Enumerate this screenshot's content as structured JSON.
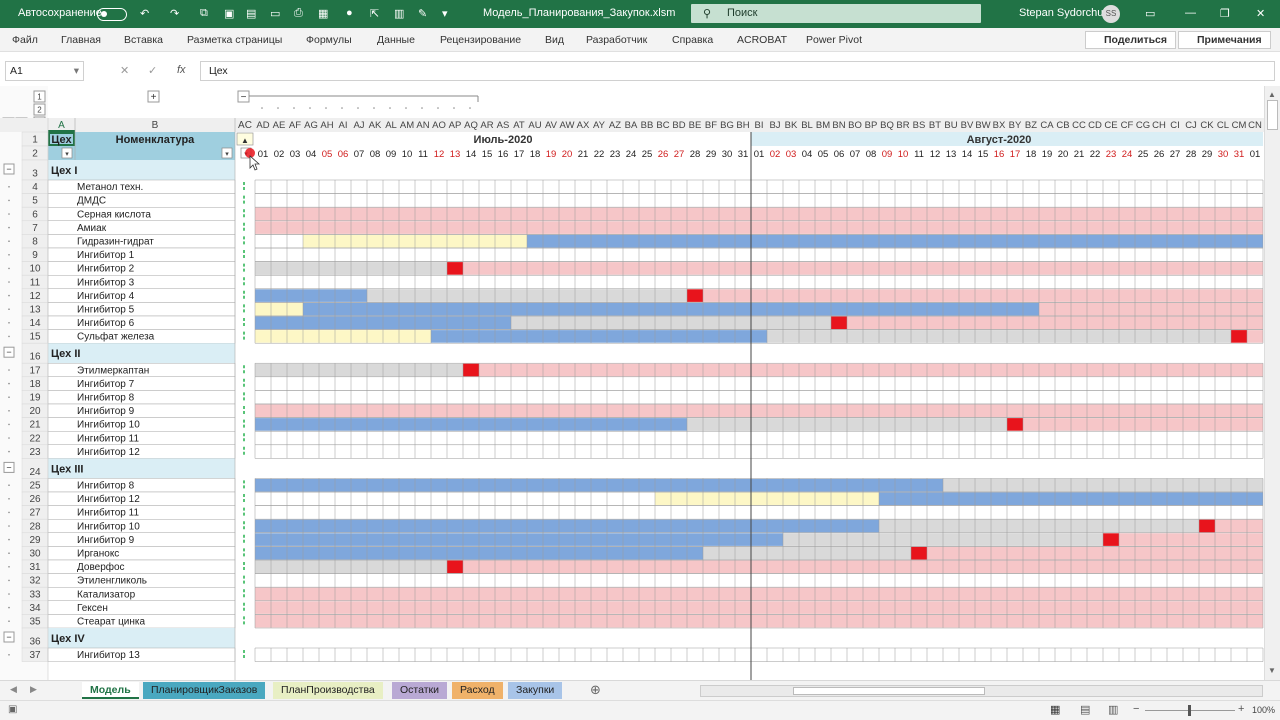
{
  "titlebar": {
    "autosave_label": "Автосохранение",
    "filename": "Модель_Планирования_Закупок.xlsm",
    "search_placeholder": "Поиск",
    "user": "Stepan Sydorchuk",
    "user_initials": "SS"
  },
  "ribbon": {
    "tabs": [
      "Файл",
      "Главная",
      "Вставка",
      "Разметка страницы",
      "Формулы",
      "Данные",
      "Рецензирование",
      "Вид",
      "Разработчик",
      "Справка",
      "ACROBAT",
      "Power Pivot"
    ],
    "share": "Поделиться",
    "comments": "Примечания"
  },
  "formulabar": {
    "name_box": "A1",
    "fx": "fx",
    "value": "Цех"
  },
  "sheet": {
    "col_a": "A",
    "col_b": "B",
    "header_a": "Цех",
    "header_b": "Номенклатура",
    "months": [
      "Июль-2020",
      "Август-2020"
    ],
    "col_letters": [
      "AC",
      "AD",
      "AE",
      "AF",
      "AG",
      "AH",
      "AI",
      "AJ",
      "AK",
      "AL",
      "AM",
      "AN",
      "AO",
      "AP",
      "AQ",
      "AR",
      "AS",
      "AT",
      "AU",
      "AV",
      "AW",
      "AX",
      "AY",
      "AZ",
      "BA",
      "BB",
      "BC",
      "BD",
      "BE",
      "BF",
      "BG",
      "BH",
      "BI",
      "BJ",
      "BK",
      "BL",
      "BM",
      "BN",
      "BO",
      "BP",
      "BQ",
      "BR",
      "BS",
      "BT",
      "BU",
      "BV",
      "BW",
      "BX",
      "BY",
      "BZ",
      "CA",
      "CB",
      "CC",
      "CD",
      "CE",
      "CF",
      "CG",
      "CH",
      "CI",
      "CJ",
      "CK",
      "CL",
      "CM",
      "CN"
    ],
    "days": [
      "01",
      "02",
      "03",
      "04",
      "05",
      "06",
      "07",
      "08",
      "09",
      "10",
      "11",
      "12",
      "13",
      "14",
      "15",
      "16",
      "17",
      "18",
      "19",
      "20",
      "21",
      "22",
      "23",
      "24",
      "25",
      "26",
      "27",
      "28",
      "29",
      "30",
      "31",
      "01",
      "02",
      "03",
      "04",
      "05",
      "06",
      "07",
      "08",
      "09",
      "10",
      "11",
      "12",
      "13",
      "14",
      "15",
      "16",
      "17",
      "18",
      "19",
      "20",
      "21",
      "22",
      "23",
      "24",
      "25",
      "26",
      "27",
      "28",
      "29",
      "30",
      "31",
      "01"
    ],
    "weekend_days": [
      4,
      5,
      11,
      12,
      18,
      19,
      25,
      26,
      32,
      33,
      39,
      40,
      46,
      47,
      53,
      54,
      60,
      61
    ],
    "rows": [
      {
        "n": "1",
        "type": "header"
      },
      {
        "n": "2",
        "type": "filter"
      },
      {
        "n": "3",
        "type": "group",
        "label": "Цех I"
      },
      {
        "n": "4",
        "type": "item",
        "label": "Метанол техн.",
        "pattern": "white"
      },
      {
        "n": "5",
        "type": "item",
        "label": "ДМДС",
        "pattern": "white"
      },
      {
        "n": "6",
        "type": "item",
        "label": "Серная кислота",
        "pattern": "pink"
      },
      {
        "n": "7",
        "type": "item",
        "label": "Амиак",
        "pattern": "pink"
      },
      {
        "n": "8",
        "type": "item",
        "label": "Гидразин-гидрат",
        "segments": [
          [
            0,
            3,
            "white"
          ],
          [
            3,
            17,
            "yellow"
          ],
          [
            17,
            63,
            "blue"
          ]
        ]
      },
      {
        "n": "9",
        "type": "item",
        "label": "Ингибитор 1",
        "pattern": "white"
      },
      {
        "n": "10",
        "type": "item",
        "label": "Ингибитор 2",
        "segments": [
          [
            0,
            12,
            "gray"
          ],
          [
            12,
            13,
            "red"
          ],
          [
            13,
            63,
            "pink"
          ]
        ]
      },
      {
        "n": "11",
        "type": "item",
        "label": "Ингибитор 3",
        "pattern": "white"
      },
      {
        "n": "12",
        "type": "item",
        "label": "Ингибитор 4",
        "segments": [
          [
            0,
            7,
            "blue"
          ],
          [
            7,
            27,
            "gray"
          ],
          [
            27,
            28,
            "red"
          ],
          [
            28,
            63,
            "pink"
          ]
        ]
      },
      {
        "n": "13",
        "type": "item",
        "label": "Ингибитор 5",
        "segments": [
          [
            0,
            3,
            "yellow"
          ],
          [
            3,
            49,
            "blue"
          ],
          [
            49,
            63,
            "pink"
          ]
        ]
      },
      {
        "n": "14",
        "type": "item",
        "label": "Ингибитор 6",
        "segments": [
          [
            0,
            16,
            "blue"
          ],
          [
            16,
            36,
            "gray"
          ],
          [
            36,
            37,
            "red"
          ],
          [
            37,
            63,
            "pink"
          ]
        ]
      },
      {
        "n": "15",
        "type": "item",
        "label": "Сульфат железа",
        "segments": [
          [
            0,
            11,
            "yellow"
          ],
          [
            11,
            32,
            "blue"
          ],
          [
            32,
            61,
            "gray"
          ],
          [
            61,
            62,
            "red"
          ],
          [
            62,
            63,
            "pink"
          ]
        ]
      },
      {
        "n": "16",
        "type": "group",
        "label": "Цех II"
      },
      {
        "n": "17",
        "type": "item",
        "label": "Этилмеркаптан",
        "segments": [
          [
            0,
            13,
            "gray"
          ],
          [
            13,
            14,
            "red"
          ],
          [
            14,
            63,
            "pink"
          ]
        ]
      },
      {
        "n": "18",
        "type": "item",
        "label": "Ингибитор 7",
        "pattern": "white"
      },
      {
        "n": "19",
        "type": "item",
        "label": "Ингибитор 8",
        "pattern": "white"
      },
      {
        "n": "20",
        "type": "item",
        "label": "Ингибитор 9",
        "pattern": "pink"
      },
      {
        "n": "21",
        "type": "item",
        "label": "Ингибитор 10",
        "segments": [
          [
            0,
            27,
            "blue"
          ],
          [
            27,
            47,
            "gray"
          ],
          [
            47,
            48,
            "red"
          ],
          [
            48,
            63,
            "pink"
          ]
        ]
      },
      {
        "n": "22",
        "type": "item",
        "label": "Ингибитор 11",
        "pattern": "white"
      },
      {
        "n": "23",
        "type": "item",
        "label": "Ингибитор 12",
        "pattern": "white"
      },
      {
        "n": "24",
        "type": "group",
        "label": "Цех III"
      },
      {
        "n": "25",
        "type": "item",
        "label": "Ингибитор 8",
        "segments": [
          [
            0,
            43,
            "blue"
          ],
          [
            43,
            63,
            "gray"
          ]
        ]
      },
      {
        "n": "26",
        "type": "item",
        "label": "Ингибитор 12",
        "segments": [
          [
            0,
            25,
            "white"
          ],
          [
            25,
            39,
            "yellow"
          ],
          [
            39,
            63,
            "blue"
          ]
        ]
      },
      {
        "n": "27",
        "type": "item",
        "label": "Ингибитор 11",
        "pattern": "white"
      },
      {
        "n": "28",
        "type": "item",
        "label": "Ингибитор 10",
        "segments": [
          [
            0,
            39,
            "blue"
          ],
          [
            39,
            59,
            "gray"
          ],
          [
            59,
            60,
            "red"
          ],
          [
            60,
            63,
            "pink"
          ]
        ]
      },
      {
        "n": "29",
        "type": "item",
        "label": "Ингибитор 9",
        "segments": [
          [
            0,
            33,
            "blue"
          ],
          [
            33,
            53,
            "gray"
          ],
          [
            53,
            54,
            "red"
          ],
          [
            54,
            63,
            "pink"
          ]
        ]
      },
      {
        "n": "30",
        "type": "item",
        "label": "Ирганокс",
        "segments": [
          [
            0,
            28,
            "blue"
          ],
          [
            28,
            41,
            "gray"
          ],
          [
            41,
            42,
            "red"
          ],
          [
            42,
            63,
            "pink"
          ]
        ]
      },
      {
        "n": "31",
        "type": "item",
        "label": "Доверфос",
        "segments": [
          [
            0,
            12,
            "gray"
          ],
          [
            12,
            13,
            "red"
          ],
          [
            13,
            63,
            "pink"
          ]
        ]
      },
      {
        "n": "32",
        "type": "item",
        "label": "Этиленгликоль",
        "pattern": "white"
      },
      {
        "n": "33",
        "type": "item",
        "label": "Катализатор",
        "pattern": "pink"
      },
      {
        "n": "34",
        "type": "item",
        "label": "Гексен",
        "pattern": "pink"
      },
      {
        "n": "35",
        "type": "item",
        "label": "Стеарат цинка",
        "pattern": "pink"
      },
      {
        "n": "36",
        "type": "group",
        "label": "Цех IV"
      },
      {
        "n": "37",
        "type": "item",
        "label": "Ингибитор 13",
        "pattern": "white"
      }
    ],
    "group_levels": [
      "1",
      "2",
      "3"
    ]
  },
  "sheet_tabs": [
    {
      "label": "Модель",
      "color": "#ffffff",
      "active": true
    },
    {
      "label": "ПланировщикЗаказов",
      "color": "#4aa8c0",
      "active": false
    },
    {
      "label": "ПланПроизводства",
      "color": "#e8efc4",
      "active": false
    },
    {
      "label": "Остатки",
      "color": "#b9a9d4",
      "active": false
    },
    {
      "label": "Расход",
      "color": "#f0b26a",
      "active": false
    },
    {
      "label": "Закупки",
      "color": "#a8c4e8",
      "active": false
    }
  ],
  "statusbar": {
    "zoom": "100%"
  },
  "colors": {
    "excel_green": "#217346",
    "blue": "#7fa7dc",
    "pink": "#f6c6c8",
    "gray": "#d9d9d9",
    "yellow": "#fdf7c6",
    "red": "#e8141c",
    "group_bg": "#daeef5",
    "weekend_text": "#d01c1c"
  }
}
